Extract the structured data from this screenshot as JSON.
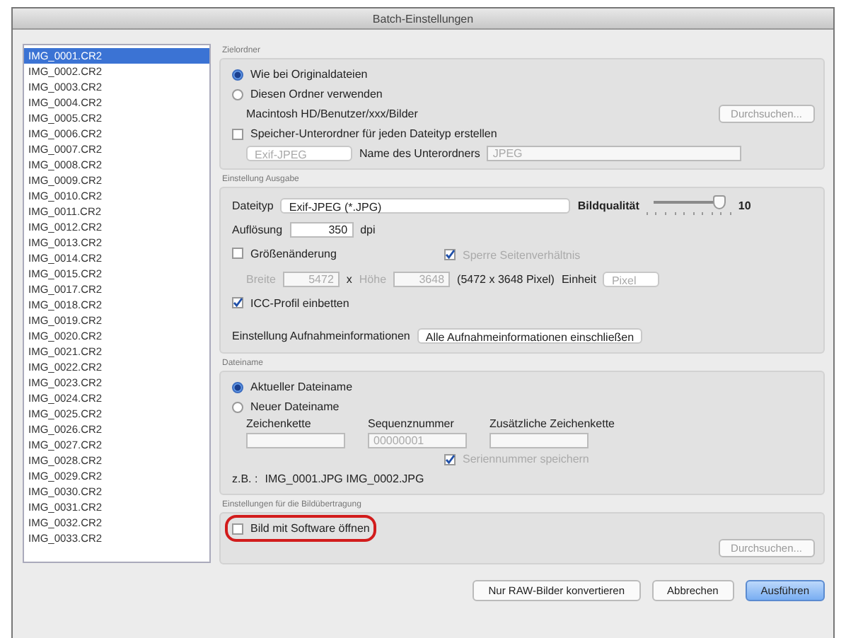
{
  "window": {
    "title": "Batch-Einstellungen"
  },
  "file_list": {
    "items": [
      {
        "label": "IMG_0001.CR2",
        "selected": true
      },
      {
        "label": "IMG_0002.CR2",
        "selected": false
      },
      {
        "label": "IMG_0003.CR2",
        "selected": false
      },
      {
        "label": "IMG_0004.CR2",
        "selected": false
      },
      {
        "label": "IMG_0005.CR2",
        "selected": false
      },
      {
        "label": "IMG_0006.CR2",
        "selected": false
      },
      {
        "label": "IMG_0007.CR2",
        "selected": false
      },
      {
        "label": "IMG_0008.CR2",
        "selected": false
      },
      {
        "label": "IMG_0009.CR2",
        "selected": false
      },
      {
        "label": "IMG_0010.CR2",
        "selected": false
      },
      {
        "label": "IMG_0011.CR2",
        "selected": false
      },
      {
        "label": "IMG_0012.CR2",
        "selected": false
      },
      {
        "label": "IMG_0013.CR2",
        "selected": false
      },
      {
        "label": "IMG_0014.CR2",
        "selected": false
      },
      {
        "label": "IMG_0015.CR2",
        "selected": false
      },
      {
        "label": "IMG_0017.CR2",
        "selected": false
      },
      {
        "label": "IMG_0018.CR2",
        "selected": false
      },
      {
        "label": "IMG_0019.CR2",
        "selected": false
      },
      {
        "label": "IMG_0020.CR2",
        "selected": false
      },
      {
        "label": "IMG_0021.CR2",
        "selected": false
      },
      {
        "label": "IMG_0022.CR2",
        "selected": false
      },
      {
        "label": "IMG_0023.CR2",
        "selected": false
      },
      {
        "label": "IMG_0024.CR2",
        "selected": false
      },
      {
        "label": "IMG_0025.CR2",
        "selected": false
      },
      {
        "label": "IMG_0026.CR2",
        "selected": false
      },
      {
        "label": "IMG_0027.CR2",
        "selected": false
      },
      {
        "label": "IMG_0028.CR2",
        "selected": false
      },
      {
        "label": "IMG_0029.CR2",
        "selected": false
      },
      {
        "label": "IMG_0030.CR2",
        "selected": false
      },
      {
        "label": "IMG_0031.CR2",
        "selected": false
      },
      {
        "label": "IMG_0032.CR2",
        "selected": false
      },
      {
        "label": "IMG_0033.CR2",
        "selected": false
      }
    ]
  },
  "destination": {
    "title": "Zielordner",
    "options": [
      {
        "label": "Wie bei Originaldateien",
        "selected": true
      },
      {
        "label": "Diesen Ordner verwenden",
        "selected": false
      }
    ],
    "path": "Macintosh HD/Benutzer/xxx/Bilder",
    "browse_button": {
      "label": "Durchsuchen...",
      "disabled": true
    },
    "subfolder": {
      "label": "Speicher-Unterordner für jeden Dateityp erstellen",
      "checked": false,
      "type_value": "Exif-JPEG",
      "name_label": "Name des Unterordners",
      "name_value": "JPEG"
    }
  },
  "output": {
    "title": "Einstellung Ausgabe",
    "file_type_label": "Dateityp",
    "file_type_value": "Exif-JPEG (*.JPG)",
    "quality_label": "Bildqualität",
    "quality": {
      "level": 0.95,
      "value": "10"
    },
    "resolution_label": "Auflösung",
    "resolution_value": "350",
    "resolution_unit": "dpi",
    "resize": {
      "label": "Größenänderung",
      "checked": false
    },
    "aspect": {
      "label": "Sperre Seitenverhältnis",
      "checked": true
    },
    "width_label": "Breite",
    "width_value": "5472",
    "times": "x",
    "height_label": "Höhe",
    "height_value": "3648",
    "pixel_size": "(5472 x 3648 Pixel)",
    "unit_label": "Einheit",
    "unit_value": "Pixel",
    "icc": {
      "label": "ICC-Profil einbetten",
      "checked": true
    },
    "info_label": "Einstellung Aufnahmeinformationen",
    "info_value": "Alle Aufnahmeinformationen einschließen"
  },
  "filename": {
    "title": "Dateiname",
    "options": [
      {
        "label": "Aktueller Dateiname",
        "selected": true
      },
      {
        "label": "Neuer Dateiname",
        "selected": false
      }
    ],
    "fields": [
      {
        "label": "Zeichenkette"
      },
      {
        "label": "Sequenznummer",
        "value": "00000001"
      },
      {
        "label": "Zusätzliche Zeichenkette"
      }
    ],
    "keep_sequence": {
      "label": "Seriennummer speichern",
      "checked": true
    },
    "example_label": "z.B. :",
    "example_value": "IMG_0001.JPG IMG_0002.JPG"
  },
  "transfer": {
    "title": "Einstellungen für die Bildübertragung",
    "open_with": {
      "label": "Bild mit Software öffnen",
      "checked": false,
      "highlighted": true
    },
    "browse_button": {
      "label": "Durchsuchen...",
      "disabled": true
    }
  },
  "buttons": [
    {
      "label": "Nur RAW-Bilder konvertieren",
      "default": false
    },
    {
      "label": "Abbrechen",
      "default": false
    },
    {
      "label": "Ausführen",
      "default": true
    }
  ]
}
